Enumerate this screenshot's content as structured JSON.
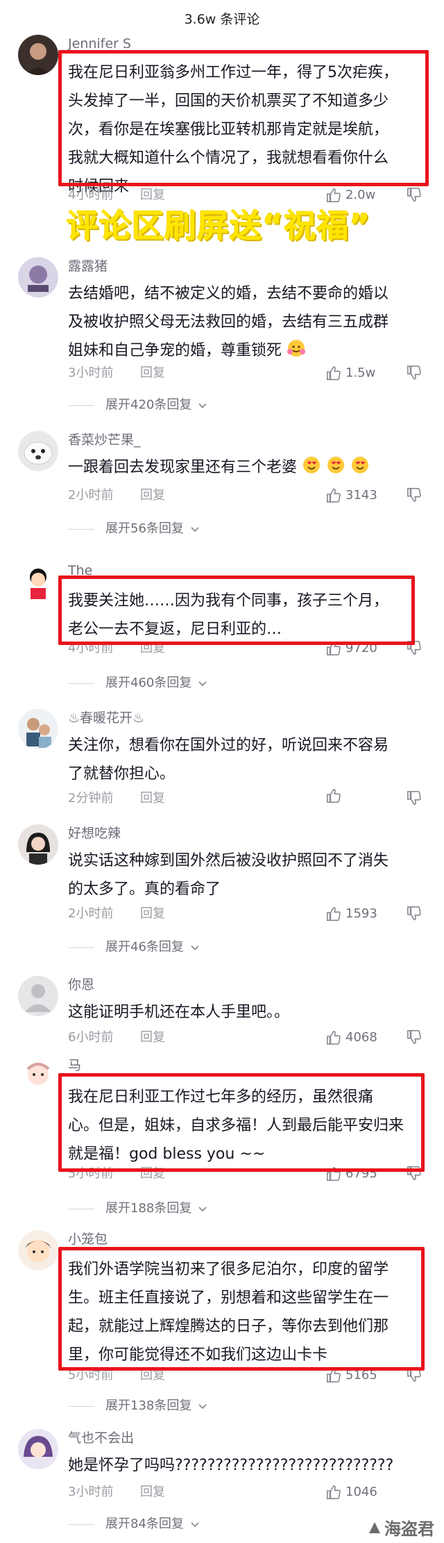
{
  "header": {
    "title": "3.6w 条评论"
  },
  "banner": {
    "text": "评论区刷屏送“祝福”"
  },
  "watermark": {
    "text": "海盗君"
  },
  "labels": {
    "reply": "回复"
  },
  "comments": [
    {
      "username": "Jennifer S",
      "lines": [
        "我在尼日利亚翁多州工作过一年，得了5次疟疾，",
        "头发掉了一半，回国的天价机票买了不知道多少",
        "次，看你是在埃塞俄比亚转机那肯定就是埃航，",
        "我就大概知道什么个情况了，我就想看看你什么",
        "时候回来"
      ],
      "time": "4小时前",
      "likes": "2.0w",
      "highlighted": true
    },
    {
      "username": "露露猪",
      "lines": [
        "去结婚吧，结不被定义的婚，去结不要命的婚以",
        "及被收护照父母无法救回的婚，去结有三五成群",
        "姐妹和自己争宠的婚，尊重锁死"
      ],
      "emoji_count": 1,
      "time": "3小时前",
      "likes": "1.5w",
      "replies": "展开420条回复"
    },
    {
      "username": "香菜炒芒果_",
      "lines": [
        "一跟着回去发现家里还有三个老婆"
      ],
      "emoji_count": 3,
      "time": "2小时前",
      "likes": "3143",
      "replies": "展开56条回复"
    },
    {
      "username": "The",
      "lines": [
        "我要关注她……因为我有个同事，孩子三个月，",
        "老公一去不复返，尼日利亚的…"
      ],
      "time": "4小时前",
      "likes": "9720",
      "replies": "展开460条回复",
      "highlighted": true
    },
    {
      "username": "♨春暖花开♨",
      "lines": [
        "关注你，想看你在国外过的好，听说回来不容易",
        "了就替你担心。"
      ],
      "time": "2分钟前",
      "likes": ""
    },
    {
      "username": "好想吃辣",
      "lines": [
        "说实话这种嫁到国外然后被没收护照回不了消失",
        "的太多了。真的看命了"
      ],
      "time": "2小时前",
      "likes": "1593",
      "replies": "展开46条回复"
    },
    {
      "username": "你恩",
      "lines": [
        "这能证明手机还在本人手里吧。。"
      ],
      "time": "6小时前",
      "likes": "4068"
    },
    {
      "username": "马",
      "lines": [
        "我在尼日利亚工作过七年多的经历，虽然很痛",
        "心。但是，姐妹，自求多福！人到最后能平安归来",
        "就是福！god bless you ~~"
      ],
      "time": "5小时前",
      "likes": "6795",
      "replies": "展开188条回复",
      "highlighted": true
    },
    {
      "username": "小笼包",
      "lines": [
        "我们外语学院当初来了很多尼泊尔，印度的留学",
        "生。班主任直接说了，别想着和这些留学生在一",
        "起，就能过上辉煌腾达的日子，等你去到他们那",
        "里，你可能觉得还不如我们这边山卡卡"
      ],
      "time": "5小时前",
      "likes": "5165",
      "replies": "展开138条回复",
      "highlighted": true
    },
    {
      "username": "气也不会出",
      "lines": [
        "她是怀孕了吗吗???????????????????????????"
      ],
      "time": "3小时前",
      "likes": "1046",
      "replies": "展开84条回复"
    }
  ]
}
